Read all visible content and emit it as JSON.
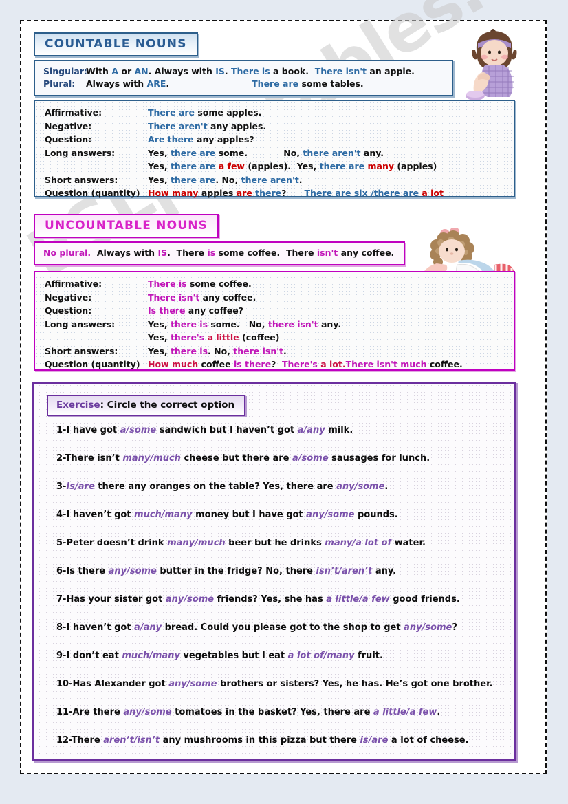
{
  "watermark": "ESLprintables.com",
  "sections": {
    "countable": {
      "title": "COUNTABLE NOUNS",
      "rule_rows": [
        {
          "label": "Singular:",
          "plain1": "With ",
          "c1": "A",
          "plain2": " or ",
          "c2": "AN",
          "plain3": ". Always with ",
          "c3": "IS",
          "plain4": ". ",
          "ex1": "There is",
          "ex1b": " a book.",
          "ex2": "There isn't",
          "ex2b": " an apple."
        },
        {
          "label": "Plural:",
          "plain1": "Always with ",
          "c1": "ARE",
          "plain2": ".",
          "ex1": "There are",
          "ex1b": " some tables."
        }
      ],
      "rows": [
        {
          "label": "Affirmative:",
          "segments": [
            {
              "t": "There are",
              "c": "blue"
            },
            {
              "t": " some apples.",
              "c": "dark"
            }
          ]
        },
        {
          "label": "Negative:",
          "segments": [
            {
              "t": "There aren't",
              "c": "blue"
            },
            {
              "t": " any apples.",
              "c": "dark"
            }
          ]
        },
        {
          "label": "Question:",
          "segments": [
            {
              "t": "Are there",
              "c": "blue"
            },
            {
              "t": " any apples?",
              "c": "dark"
            }
          ]
        },
        {
          "label": "Long answers:",
          "segments": [
            {
              "t": "Yes, ",
              "c": "dark"
            },
            {
              "t": "there are",
              "c": "blue"
            },
            {
              "t": " some.",
              "c": "dark"
            },
            {
              "t": "            ",
              "c": "dark"
            },
            {
              "t": "No, ",
              "c": "dark"
            },
            {
              "t": "there aren't",
              "c": "blue"
            },
            {
              "t": " any.",
              "c": "dark"
            }
          ]
        },
        {
          "label": "",
          "segments": [
            {
              "t": "Yes, ",
              "c": "dark"
            },
            {
              "t": "there are",
              "c": "blue"
            },
            {
              "t": " ",
              "c": "dark"
            },
            {
              "t": "a few",
              "c": "red"
            },
            {
              "t": " (apples).  ",
              "c": "dark"
            },
            {
              "t": "Yes, ",
              "c": "dark"
            },
            {
              "t": "there are",
              "c": "blue"
            },
            {
              "t": " ",
              "c": "dark"
            },
            {
              "t": "many",
              "c": "red"
            },
            {
              "t": " (apples)",
              "c": "dark"
            }
          ]
        },
        {
          "label": "Short answers:",
          "segments": [
            {
              "t": "Yes, ",
              "c": "dark"
            },
            {
              "t": "there are",
              "c": "blue"
            },
            {
              "t": ". No, ",
              "c": "dark"
            },
            {
              "t": "there aren't",
              "c": "blue"
            },
            {
              "t": ".",
              "c": "dark"
            }
          ]
        },
        {
          "label": "Question (quantity)",
          "segments": [
            {
              "t": "How many",
              "c": "red"
            },
            {
              "t": " apples ",
              "c": "dark"
            },
            {
              "t": "are",
              "c": "red"
            },
            {
              "t": " ",
              "c": "dark"
            },
            {
              "t": "there",
              "c": "blue"
            },
            {
              "t": "?      ",
              "c": "dark"
            },
            {
              "t": "There are six /there are ",
              "c": "blue"
            },
            {
              "t": "a lot",
              "c": "red"
            }
          ]
        }
      ]
    },
    "uncountable": {
      "title": "UNCOUNTABLE NOUNS",
      "rule_segments": [
        {
          "t": "No plural.",
          "c": "mag"
        },
        {
          "t": "  Always with ",
          "c": "dark"
        },
        {
          "t": "IS",
          "c": "mag"
        },
        {
          "t": ".  There ",
          "c": "dark"
        },
        {
          "t": "is",
          "c": "mag"
        },
        {
          "t": " some coffee.  There ",
          "c": "dark"
        },
        {
          "t": "isn't",
          "c": "mag"
        },
        {
          "t": " any coffee.",
          "c": "dark"
        }
      ],
      "rows": [
        {
          "label": "Affirmative:",
          "segments": [
            {
              "t": "There is",
              "c": "mag"
            },
            {
              "t": " some coffee.",
              "c": "dark"
            }
          ]
        },
        {
          "label": "Negative:",
          "segments": [
            {
              "t": "There isn't",
              "c": "mag"
            },
            {
              "t": " any coffee.",
              "c": "dark"
            }
          ]
        },
        {
          "label": "Question:",
          "segments": [
            {
              "t": "Is there",
              "c": "mag"
            },
            {
              "t": " any coffee?",
              "c": "dark"
            }
          ]
        },
        {
          "label": "Long answers:",
          "segments": [
            {
              "t": "Yes, ",
              "c": "dark"
            },
            {
              "t": "there is",
              "c": "mag"
            },
            {
              "t": " some.   No, ",
              "c": "dark"
            },
            {
              "t": "there isn't",
              "c": "mag"
            },
            {
              "t": " any.",
              "c": "dark"
            }
          ]
        },
        {
          "label": "",
          "segments": [
            {
              "t": "Yes, ",
              "c": "dark"
            },
            {
              "t": "there's",
              "c": "mag"
            },
            {
              "t": " ",
              "c": "dark"
            },
            {
              "t": "a little",
              "c": "crim"
            },
            {
              "t": " (coffee)",
              "c": "dark"
            }
          ]
        },
        {
          "label": "Short answers:",
          "segments": [
            {
              "t": "Yes, ",
              "c": "dark"
            },
            {
              "t": "there is",
              "c": "mag"
            },
            {
              "t": ". No, ",
              "c": "dark"
            },
            {
              "t": "there isn't",
              "c": "mag"
            },
            {
              "t": ".",
              "c": "dark"
            }
          ]
        },
        {
          "label": "Question (quantity)",
          "segments": [
            {
              "t": "How much",
              "c": "crim"
            },
            {
              "t": " coffee ",
              "c": "dark"
            },
            {
              "t": "is there",
              "c": "mag"
            },
            {
              "t": "?  ",
              "c": "dark"
            },
            {
              "t": "There's",
              "c": "mag"
            },
            {
              "t": " ",
              "c": "dark"
            },
            {
              "t": "a lot.",
              "c": "crim"
            },
            {
              "t": "There isn't much",
              "c": "mag"
            },
            {
              "t": " coffee.",
              "c": "dark"
            }
          ]
        }
      ]
    },
    "exercise": {
      "heading_label": "Exercise",
      "heading_rest": ": Circle the correct option",
      "items": [
        {
          "n": "1-",
          "parts": [
            {
              "t": "I have got ",
              "i": false
            },
            {
              "t": "a/some",
              "i": true
            },
            {
              "t": " sandwich but I haven’t got ",
              "i": false
            },
            {
              "t": "a/any",
              "i": true
            },
            {
              "t": " milk.",
              "i": false
            }
          ]
        },
        {
          "n": "2-",
          "parts": [
            {
              "t": "There isn’t ",
              "i": false
            },
            {
              "t": "many/much",
              "i": true
            },
            {
              "t": " cheese but there are ",
              "i": false
            },
            {
              "t": "a/some",
              "i": true
            },
            {
              "t": " sausages for lunch.",
              "i": false
            }
          ]
        },
        {
          "n": "3-",
          "parts": [
            {
              "t": "Is/are",
              "i": true
            },
            {
              "t": " there any oranges on the table? Yes, there are ",
              "i": false
            },
            {
              "t": "any/some",
              "i": true
            },
            {
              "t": ".",
              "i": false
            }
          ]
        },
        {
          "n": "4-",
          "parts": [
            {
              "t": "I haven’t got ",
              "i": false
            },
            {
              "t": "much/many",
              "i": true
            },
            {
              "t": " money but I have got ",
              "i": false
            },
            {
              "t": "any/some",
              "i": true
            },
            {
              "t": " pounds.",
              "i": false
            }
          ]
        },
        {
          "n": "5-",
          "parts": [
            {
              "t": "Peter doesn’t drink ",
              "i": false
            },
            {
              "t": "many/much",
              "i": true
            },
            {
              "t": " beer but he drinks ",
              "i": false
            },
            {
              "t": "many/a lot of",
              "i": true
            },
            {
              "t": " water.",
              "i": false
            }
          ]
        },
        {
          "n": "6-",
          "parts": [
            {
              "t": "Is there ",
              "i": false
            },
            {
              "t": "any/some",
              "i": true
            },
            {
              "t": " butter in the fridge? No, there ",
              "i": false
            },
            {
              "t": "isn’t/aren’t",
              "i": true
            },
            {
              "t": " any.",
              "i": false
            }
          ]
        },
        {
          "n": "7-",
          "parts": [
            {
              "t": "Has your sister got ",
              "i": false
            },
            {
              "t": "any/some",
              "i": true
            },
            {
              "t": " friends? Yes, she has ",
              "i": false
            },
            {
              "t": "a little/a few",
              "i": true
            },
            {
              "t": " good friends.",
              "i": false
            }
          ]
        },
        {
          "n": "8-",
          "parts": [
            {
              "t": "I haven’t got ",
              "i": false
            },
            {
              "t": "a/any",
              "i": true
            },
            {
              "t": " bread. Could you please got to the shop to get ",
              "i": false
            },
            {
              "t": "any/some",
              "i": true
            },
            {
              "t": "?",
              "i": false
            }
          ]
        },
        {
          "n": "9-",
          "parts": [
            {
              "t": "I don’t eat ",
              "i": false
            },
            {
              "t": "much/many",
              "i": true
            },
            {
              "t": " vegetables but I eat ",
              "i": false
            },
            {
              "t": "a lot of/many",
              "i": true
            },
            {
              "t": " fruit.",
              "i": false
            }
          ]
        },
        {
          "n": "10-",
          "parts": [
            {
              "t": "Has Alexander got ",
              "i": false
            },
            {
              "t": "any/some",
              "i": true
            },
            {
              "t": " brothers or sisters? Yes, he has. He’s got one brother.",
              "i": false
            }
          ]
        },
        {
          "n": "11-",
          "parts": [
            {
              "t": "Are there ",
              "i": false
            },
            {
              "t": "any/some",
              "i": true
            },
            {
              "t": " tomatoes in the basket? Yes, there are ",
              "i": false
            },
            {
              "t": "a little/a few",
              "i": true
            },
            {
              "t": ".",
              "i": false
            }
          ]
        },
        {
          "n": "12-",
          "parts": [
            {
              "t": "There ",
              "i": false
            },
            {
              "t": "aren’t/isn’t",
              "i": true
            },
            {
              "t": " any mushrooms in this pizza but there ",
              "i": false
            },
            {
              "t": "is/are",
              "i": true
            },
            {
              "t": " a lot of cheese.",
              "i": false
            }
          ]
        }
      ]
    }
  },
  "clipart": {
    "girl_sitting": "girl-sitting-illustration",
    "doll_lying": "curly-haired-doll-illustration"
  },
  "colors": {
    "countable_blue": "#2d5f8b",
    "uncountable_magenta": "#c000c0",
    "exercise_purple": "#6b2f9e",
    "accent_red": "#cc0000",
    "option_purple": "#7b52ab"
  }
}
